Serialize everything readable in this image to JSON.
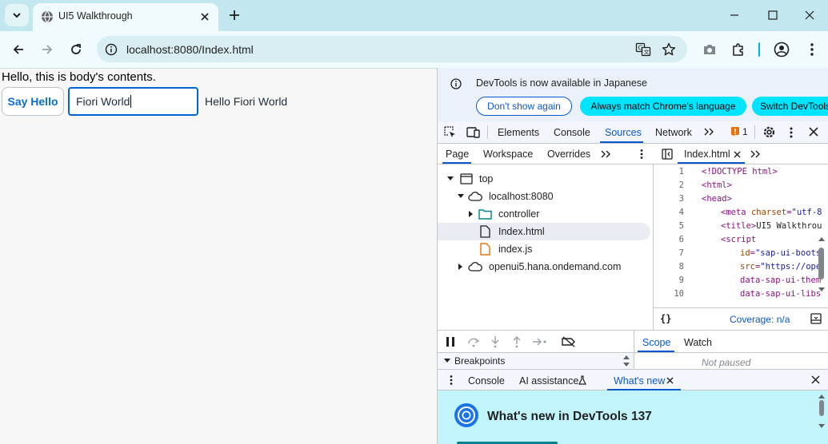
{
  "browser": {
    "tab_title": "UI5 Walkthrough",
    "url": "localhost:8080/Index.html"
  },
  "page": {
    "body_text": "Hello, this is body's contents.",
    "say_hello_label": "Say Hello",
    "input_value": "Fiori World",
    "hello_text": "Hello Fiori World"
  },
  "devtools": {
    "infobar": {
      "message": "DevTools is now available in Japanese",
      "dont_show_label": "Don't show again",
      "always_match_label": "Always match Chrome's language",
      "switch_label": "Switch DevTools"
    },
    "tabs": {
      "elements": "Elements",
      "console": "Console",
      "sources": "Sources",
      "network": "Network",
      "issues_count": "1"
    },
    "navigator": {
      "tabs": {
        "page": "Page",
        "workspace": "Workspace",
        "overrides": "Overrides"
      },
      "tree": {
        "top": "top",
        "host": "localhost:8080",
        "controller": "controller",
        "index_html": "Index.html",
        "index_js": "index.js",
        "openui5": "openui5.hana.ondemand.com"
      }
    },
    "editor": {
      "file_tab": "Index.html",
      "lines": [
        {
          "n": "1"
        },
        {
          "n": "2"
        },
        {
          "n": "3"
        },
        {
          "n": "4"
        },
        {
          "n": "5"
        },
        {
          "n": "6"
        },
        {
          "n": "7"
        },
        {
          "n": "8"
        },
        {
          "n": "9"
        },
        {
          "n": "10"
        }
      ],
      "coverage": "Coverage: n/a"
    },
    "debugger": {
      "scope_tab": "Scope",
      "watch_tab": "Watch",
      "breakpoints": "Breakpoints",
      "not_paused": "Not paused"
    },
    "drawer": {
      "console": "Console",
      "ai_assistance": "AI assistance",
      "whats_new": "What's new",
      "whats_new_title": "What's new in DevTools 137"
    }
  },
  "colors": {
    "chrome_frame": "#c2e7ee",
    "toolbar": "#f0fbfd",
    "accent": "#0b57d0",
    "ui5_blue": "#0a6ed1",
    "cyan_button": "#00e5ff"
  }
}
